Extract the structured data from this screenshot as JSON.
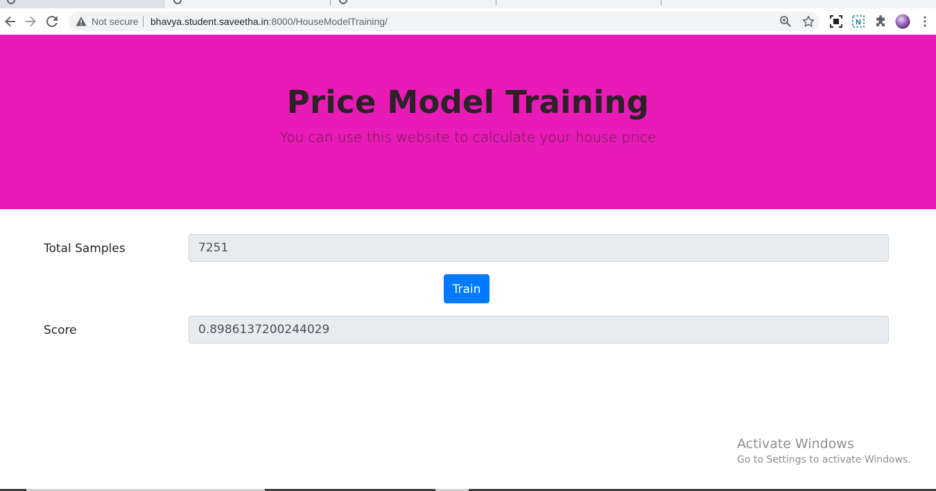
{
  "browser": {
    "security_label": "Not secure",
    "url_host": "bhavya.student.saveetha.in",
    "url_path": ":8000/HouseModelTraining/"
  },
  "hero": {
    "title": "Price Model Training",
    "subtitle": "You can use this website to calculate your house price",
    "background_color": "#e91bb6"
  },
  "form": {
    "total_samples_label": "Total Samples",
    "total_samples_value": "7251",
    "train_button_label": "Train",
    "score_label": "Score",
    "score_value": "0.8986137200244029",
    "button_color": "#007bff"
  },
  "watermark": {
    "title": "Activate Windows",
    "subtitle": "Go to Settings to activate Windows."
  },
  "icons": {
    "back": "back-arrow-icon",
    "forward": "forward-arrow-icon",
    "reload": "reload-icon",
    "warning": "warning-triangle-icon",
    "zoom": "zoom-icon",
    "bookmark": "star-icon",
    "extensions": "puzzle-icon",
    "menu": "kebab-menu-icon"
  }
}
